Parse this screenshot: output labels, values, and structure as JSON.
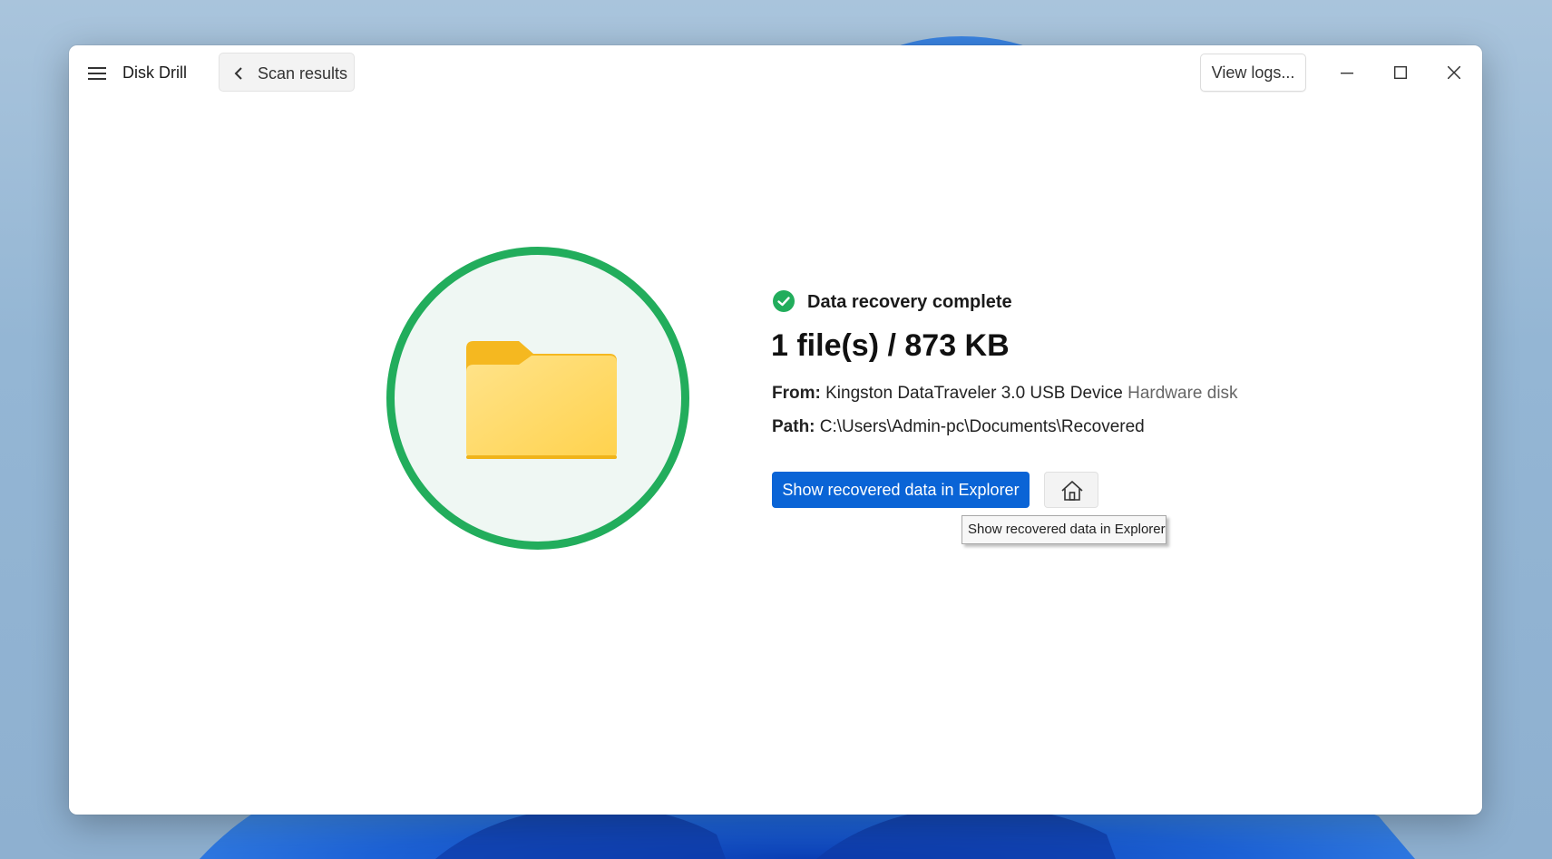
{
  "app": {
    "title": "Disk Drill"
  },
  "toolbar": {
    "back_label": "Scan results",
    "logs_label": "View logs..."
  },
  "result": {
    "status": "Data recovery complete",
    "summary": "1 file(s) / 873 KB",
    "from_label": "From:",
    "from_value": "Kingston DataTraveler 3.0 USB Device",
    "from_type": "Hardware disk",
    "path_label": "Path:",
    "path_value": "C:\\Users\\Admin-pc\\Documents\\Recovered"
  },
  "actions": {
    "show_label": "Show recovered data in Explorer",
    "tooltip": "Show recovered data in Explorer"
  },
  "colors": {
    "accent": "#0a64d6",
    "success": "#22ad5c",
    "folder": "#ffd766"
  },
  "icons": [
    "menu-icon",
    "chevron-left-icon",
    "minimize-icon",
    "maximize-icon",
    "close-icon",
    "check-circle-icon",
    "folder-icon",
    "home-icon"
  ]
}
